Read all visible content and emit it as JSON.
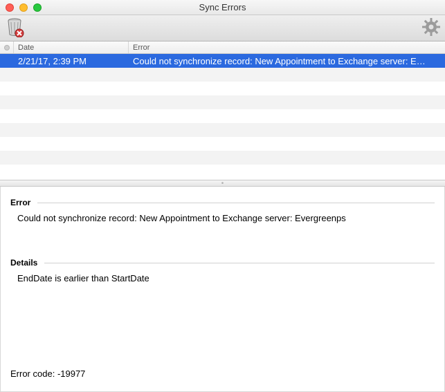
{
  "window": {
    "title": "Sync Errors"
  },
  "columns": {
    "date_label": "Date",
    "error_label": "Error"
  },
  "rows": [
    {
      "date": "2/21/17, 2:39 PM",
      "error": "Could not synchronize record: New Appointment to Exchange server: E…",
      "selected": true
    }
  ],
  "detail": {
    "error_label": "Error",
    "error_text": "Could not synchronize record: New Appointment to Exchange server: Evergreenps",
    "details_label": "Details",
    "details_text": "EndDate is earlier than StartDate",
    "error_code_label": "Error code:",
    "error_code_value": "-19977"
  },
  "icons": {
    "trash": "trash-delete-icon",
    "gear": "gear-icon"
  }
}
